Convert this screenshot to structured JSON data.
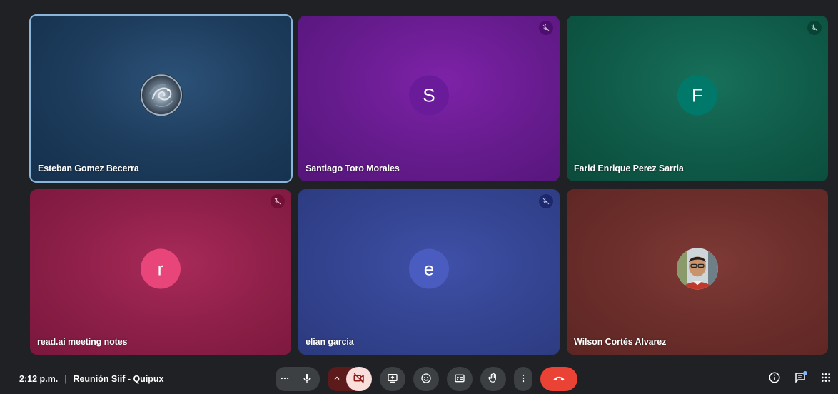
{
  "participants": [
    {
      "name": "Esteban Gomez Becerra",
      "avatar_type": "photo",
      "avatar_icon": "dragon-profile-photo",
      "bg_color": "#1c3a5a",
      "muted": false,
      "active_speaker": true
    },
    {
      "name": "Santiago Toro Morales",
      "avatar_type": "initial",
      "initial": "S",
      "avatar_color": "#6a1b9a",
      "bg_color": "#651b8c",
      "muted": true
    },
    {
      "name": "Farid Enrique Perez Sarria",
      "avatar_type": "initial",
      "initial": "F",
      "avatar_color": "#00796b",
      "bg_color": "#0f5a48",
      "muted": true
    },
    {
      "name": "read.ai meeting notes",
      "avatar_type": "initial",
      "initial": "r",
      "avatar_color": "#e8457a",
      "bg_color": "#8c1f47",
      "muted": true
    },
    {
      "name": "elian garcia",
      "avatar_type": "initial",
      "initial": "e",
      "avatar_color": "#4a5cc0",
      "bg_color": "#33438f",
      "muted": true
    },
    {
      "name": "Wilson Cortés Alvarez",
      "avatar_type": "photo",
      "avatar_icon": "person-profile-photo",
      "bg_color": "#6a2d2a",
      "muted": false
    }
  ],
  "meeting": {
    "time": "2:12 p.m.",
    "separator": "|",
    "title": "Reunión Siif - Quipux"
  },
  "controls": [
    {
      "name": "more-audio-options",
      "icon": "ellipsis-icon"
    },
    {
      "name": "microphone",
      "icon": "mic-icon"
    },
    {
      "name": "camera-options",
      "icon": "chevron-up-icon"
    },
    {
      "name": "camera-off",
      "icon": "video-off-icon",
      "state": "off"
    },
    {
      "name": "present",
      "icon": "present-screen-icon"
    },
    {
      "name": "reactions",
      "icon": "emoji-icon"
    },
    {
      "name": "captions",
      "icon": "captions-icon"
    },
    {
      "name": "raise-hand",
      "icon": "hand-icon"
    },
    {
      "name": "more-options",
      "icon": "vertical-dots-icon"
    },
    {
      "name": "leave-call",
      "icon": "hang-up-icon"
    }
  ],
  "right_tools": [
    {
      "name": "meeting-details",
      "icon": "info-icon"
    },
    {
      "name": "chat",
      "icon": "chat-icon",
      "notification": true
    },
    {
      "name": "activities",
      "icon": "grid-apps-icon"
    }
  ],
  "colors": {
    "background": "#202124",
    "control_bg": "#3c4043",
    "end_call": "#ea4335",
    "camera_off_bg": "#f9dedc",
    "active_border": "#8ab4d8"
  }
}
